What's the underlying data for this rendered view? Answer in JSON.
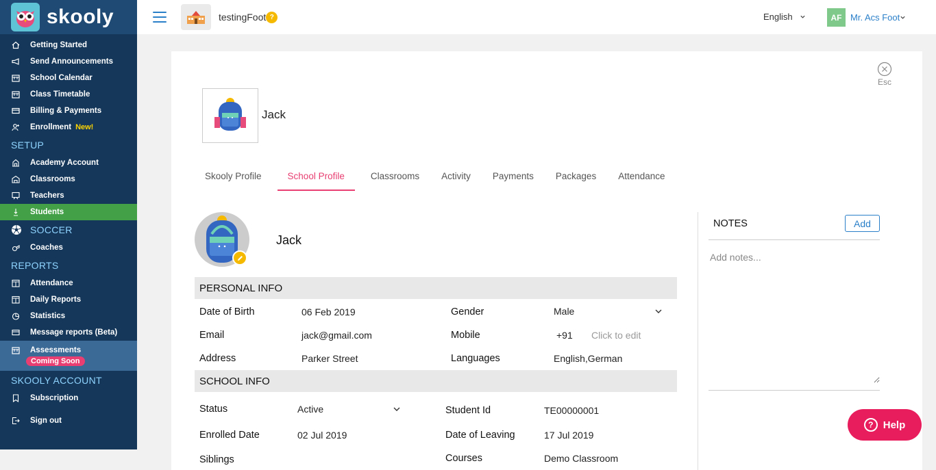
{
  "brand": {
    "name": "skooly"
  },
  "sidebar": {
    "items_top": [
      {
        "label": "Getting Started",
        "icon": "home-icon"
      },
      {
        "label": "Send Announcements",
        "icon": "megaphone-icon"
      },
      {
        "label": "School Calendar",
        "icon": "calendar-icon"
      },
      {
        "label": "Class Timetable",
        "icon": "calendar-icon"
      },
      {
        "label": "Billing & Payments",
        "icon": "card-icon"
      },
      {
        "label": "Enrollment",
        "icon": "user-add-icon",
        "badge": "New!"
      }
    ],
    "setup_title": "SETUP",
    "setup_items": [
      {
        "label": "Academy Account",
        "icon": "building-icon"
      },
      {
        "label": "Classrooms",
        "icon": "classroom-icon"
      },
      {
        "label": "Teachers",
        "icon": "teacher-icon"
      },
      {
        "label": "Students",
        "icon": "student-icon"
      }
    ],
    "soccer_title": "SOCCER",
    "soccer_items": [
      {
        "label": "Coaches",
        "icon": "whistle-icon"
      }
    ],
    "reports_title": "REPORTS",
    "reports_items": [
      {
        "label": "Attendance",
        "icon": "report-icon"
      },
      {
        "label": "Daily Reports",
        "icon": "report-icon"
      },
      {
        "label": "Statistics",
        "icon": "pie-icon"
      },
      {
        "label": "Message reports (Beta)",
        "icon": "message-icon"
      },
      {
        "label": "Assessments",
        "icon": "calendar-icon",
        "badge": "Coming Soon"
      }
    ],
    "account_title": "SKOOLY ACCOUNT",
    "account_items": [
      {
        "label": "Subscription",
        "icon": "bookmark-icon"
      },
      {
        "label": "Sign out",
        "icon": "signout-icon"
      }
    ]
  },
  "topbar": {
    "school_name": "testingFoot",
    "hint": "?",
    "language": "English",
    "user_initials": "AF",
    "user_name": "Mr. Acs Foot"
  },
  "profile": {
    "esc_label": "Esc",
    "header_name": "Jack",
    "tabs": [
      "Skooly Profile",
      "School Profile",
      "Classrooms",
      "Activity",
      "Payments",
      "Packages",
      "Attendance"
    ],
    "student_name": "Jack",
    "personal_title": "PERSONAL INFO",
    "personal": {
      "dob_label": "Date of Birth",
      "dob": "06 Feb 2019",
      "gender_label": "Gender",
      "gender": "Male",
      "email_label": "Email",
      "email": "jack@gmail.com",
      "mobile_label": "Mobile",
      "mobile_code": "+91",
      "mobile_placeholder": "Click to edit",
      "address_label": "Address",
      "address": "Parker Street",
      "languages_label": "Languages",
      "languages": "English,German"
    },
    "school_title": "SCHOOL INFO",
    "school": {
      "status_label": "Status",
      "status": "Active",
      "student_id_label": "Student Id",
      "student_id": "TE00000001",
      "enrolled_label": "Enrolled Date",
      "enrolled": "02 Jul 2019",
      "leaving_label": "Date of Leaving",
      "leaving": "17 Jul 2019",
      "siblings_label": "Siblings",
      "courses_label": "Courses",
      "courses": "Demo Classroom"
    },
    "notes": {
      "title": "NOTES",
      "add_label": "Add",
      "placeholder": "Add notes..."
    }
  },
  "help": {
    "label": "Help"
  },
  "colors": {
    "sidebar": "#15385a",
    "active_nav": "#43a047",
    "accent_pink": "#e83e71",
    "link_blue": "#2a7fc9"
  }
}
